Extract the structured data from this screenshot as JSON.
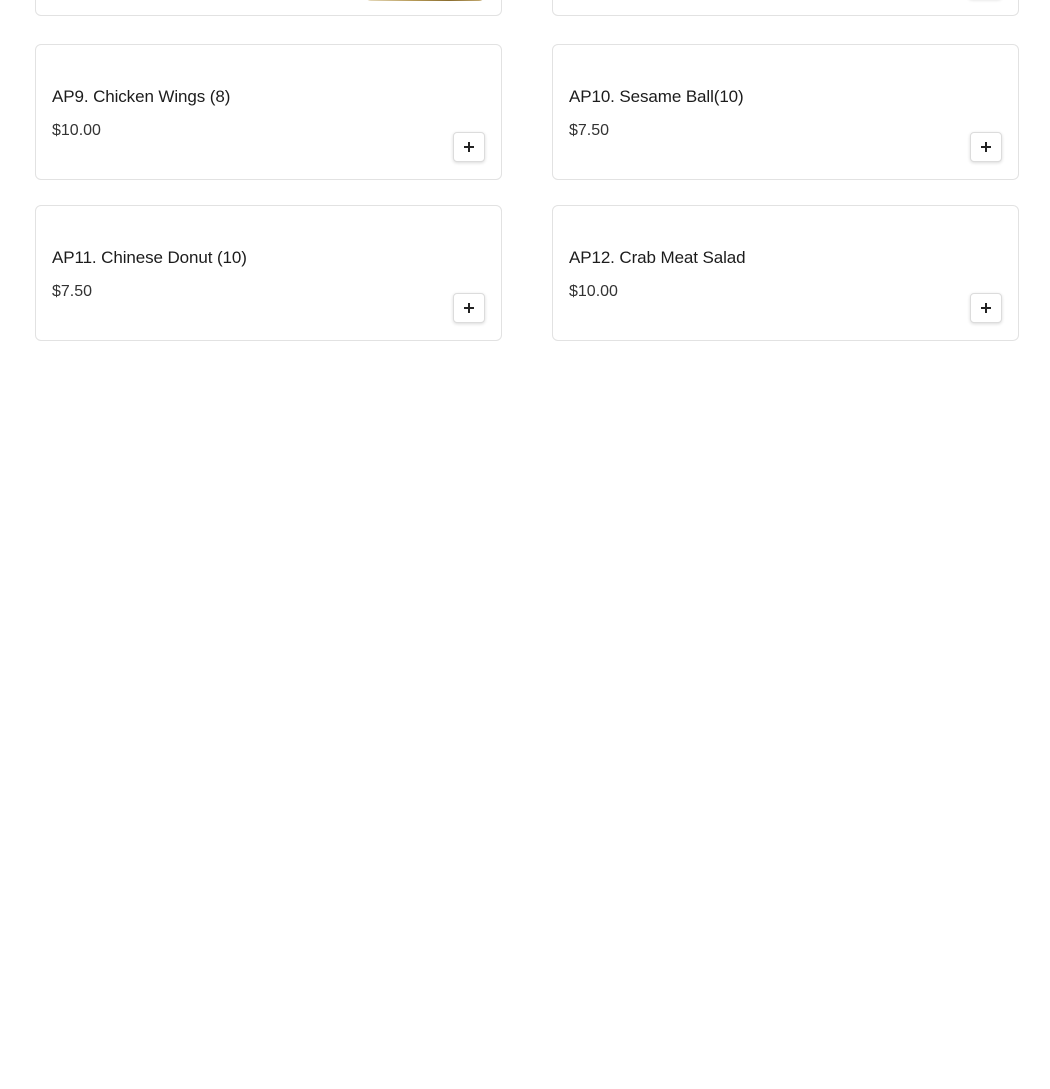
{
  "menu": {
    "items": [
      {
        "name": "AP9. Chicken Wings (8)",
        "price": "$10.00",
        "add_label": "+"
      },
      {
        "name": "AP10. Sesame Ball(10)",
        "price": "$7.50",
        "add_label": "+"
      },
      {
        "name": "AP11. Chinese Donut (10)",
        "price": "$7.50",
        "add_label": "+"
      },
      {
        "name": "AP12. Crab Meat Salad",
        "price": "$10.00",
        "add_label": "+"
      }
    ]
  },
  "icons": {
    "add": "plus-icon",
    "thumbnail": "food-photo"
  },
  "colors": {
    "card_border": "#e2e2e2",
    "text": "#1c1c1c",
    "background": "#ffffff"
  }
}
